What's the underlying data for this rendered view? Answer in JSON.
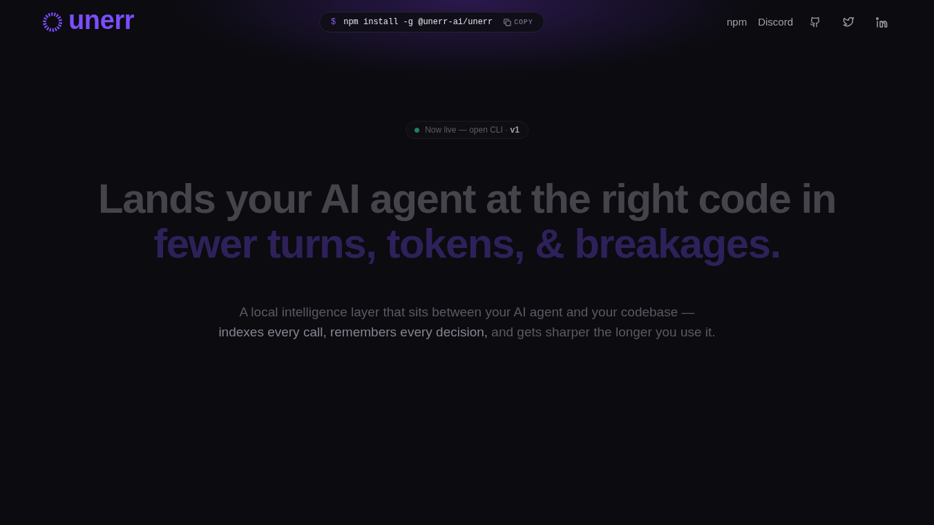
{
  "logo": {
    "wordmark": "unerr"
  },
  "install_command": {
    "prompt": "$",
    "command": "npm install -g @unerr-ai/unerr",
    "copy_label": "COPY"
  },
  "nav_links": [
    "npm",
    "Discord"
  ],
  "badge": {
    "text": "Now live — open CLI · **v1**"
  },
  "headline": {
    "line_1": "Lands your AI agent at the right code in",
    "line_2": "fewer turns, tokens, & breakages."
  },
  "subtitle": {
    "lines": [
      "A local intelligence layer that sits between your AI agent and your codebase —",
      "**indexes every call, remembers every decision,** and gets sharper the longer you use it."
    ]
  }
}
